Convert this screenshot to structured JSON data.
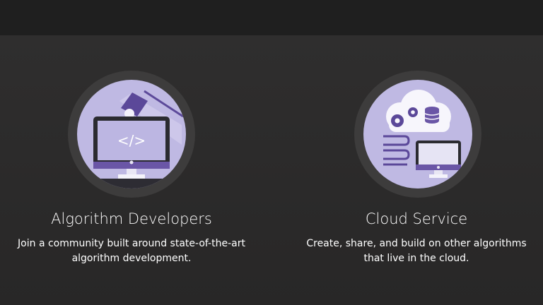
{
  "features": [
    {
      "title": "Algorithm Developers",
      "description_line1": "Join a community built around state-of-the-art",
      "description_line2": "algorithm development.",
      "icon": "developer-desk-icon",
      "code_glyph": "</>"
    },
    {
      "title": "Cloud Service",
      "description_line1": "Create, share, and build on other algorithms",
      "description_line2": "that live in the cloud.",
      "icon": "cloud-computer-icon"
    }
  ],
  "colors": {
    "background": "#2b2a2a",
    "topbar": "#1f1f1f",
    "circle_outer": "#3d3c3c",
    "circle_inner": "#bfb9e3",
    "accent_purple": "#6a56a6"
  }
}
